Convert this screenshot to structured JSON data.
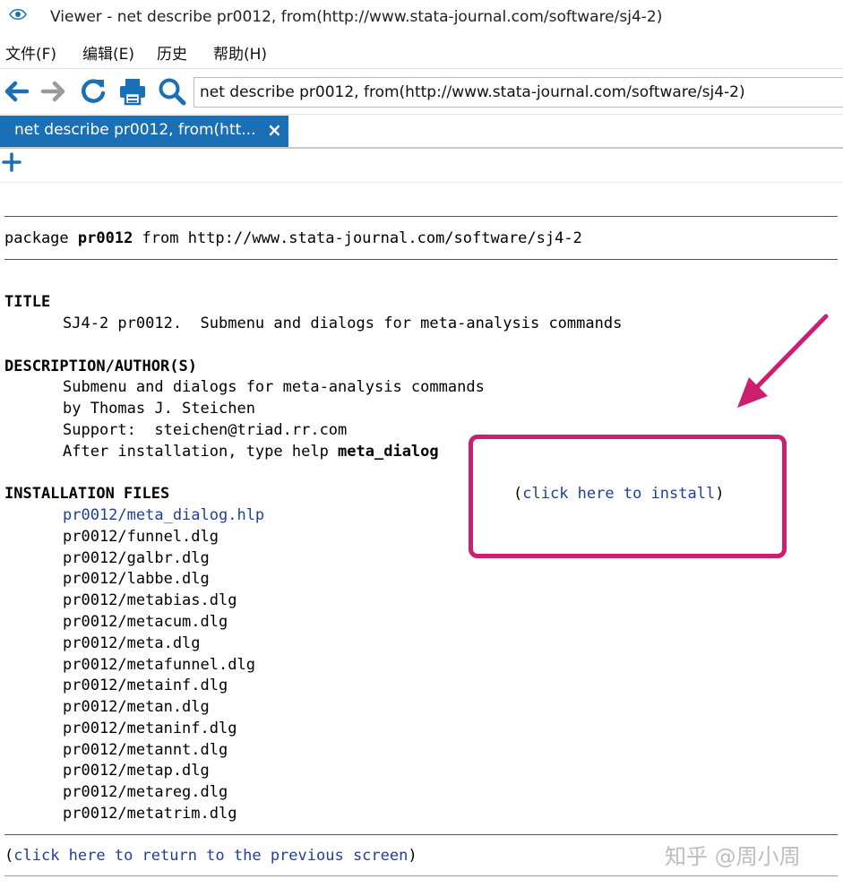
{
  "window": {
    "title": "Viewer - net describe pr0012, from(http://www.stata-journal.com/software/sj4-2)"
  },
  "menubar": {
    "items": [
      "文件(F)",
      "编辑(E)",
      "历史",
      "帮助(H)"
    ]
  },
  "toolbar": {
    "icons": [
      "back-arrow-icon",
      "forward-arrow-icon",
      "refresh-icon",
      "print-icon",
      "search-icon"
    ],
    "command_value": "net describe pr0012, from(http://www.stata-journal.com/software/sj4-2)",
    "accent_color": "#1b70b5"
  },
  "tabs": [
    {
      "label": "net describe pr0012, from(htt...",
      "close": "×"
    }
  ],
  "new_tab": "+",
  "content": {
    "header_prefix": "package ",
    "package_name": "pr0012",
    "header_suffix": " from http://www.stata-journal.com/software/sj4-2",
    "title_heading": "TITLE",
    "title_text": "SJ4-2 pr0012.  Submenu and dialogs for meta-analysis commands",
    "desc_heading": "DESCRIPTION/AUTHOR(S)",
    "desc_lines": [
      "Submenu and dialogs for meta-analysis commands",
      "by Thomas J. Steichen",
      "Support:  steichen@triad.rr.com"
    ],
    "after_prefix": "After installation, type help ",
    "after_cmd": "meta_dialog",
    "files_heading": "INSTALLATION FILES",
    "install": {
      "open": "(",
      "link": "click here to install",
      "close": ")"
    },
    "files": [
      "pr0012/meta_dialog.hlp",
      "pr0012/funnel.dlg",
      "pr0012/galbr.dlg",
      "pr0012/labbe.dlg",
      "pr0012/metabias.dlg",
      "pr0012/metacum.dlg",
      "pr0012/meta.dlg",
      "pr0012/metafunnel.dlg",
      "pr0012/metainf.dlg",
      "pr0012/metan.dlg",
      "pr0012/metaninf.dlg",
      "pr0012/metannt.dlg",
      "pr0012/metap.dlg",
      "pr0012/metareg.dlg",
      "pr0012/metatrim.dlg"
    ],
    "return": {
      "open": "(",
      "link": "click here to return to the previous screen",
      "close": ")"
    }
  },
  "annotation": {
    "highlight_color": "#cc1f6f"
  },
  "watermark": "知乎 @周小周"
}
